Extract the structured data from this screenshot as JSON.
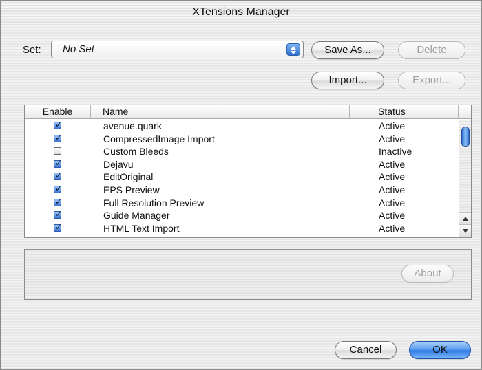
{
  "window": {
    "title": "XTensions Manager"
  },
  "set": {
    "label": "Set:",
    "selected": "No Set"
  },
  "buttons": {
    "save_as": "Save As...",
    "delete": "Delete",
    "import": "Import...",
    "export": "Export...",
    "about": "About",
    "cancel": "Cancel",
    "ok": "OK"
  },
  "table": {
    "columns": [
      "Enable",
      "Name",
      "Status"
    ],
    "rows": [
      {
        "enabled": true,
        "name": "avenue.quark",
        "status": "Active"
      },
      {
        "enabled": true,
        "name": "CompressedImage Import",
        "status": "Active"
      },
      {
        "enabled": false,
        "name": "Custom Bleeds",
        "status": "Inactive"
      },
      {
        "enabled": true,
        "name": "Dejavu",
        "status": "Active"
      },
      {
        "enabled": true,
        "name": "EditOriginal",
        "status": "Active"
      },
      {
        "enabled": true,
        "name": "EPS Preview",
        "status": "Active"
      },
      {
        "enabled": true,
        "name": "Full Resolution Preview",
        "status": "Active"
      },
      {
        "enabled": true,
        "name": "Guide Manager",
        "status": "Active"
      },
      {
        "enabled": true,
        "name": "HTML Text Import",
        "status": "Active"
      }
    ]
  },
  "icons": {
    "popup": "popup-arrows-icon",
    "checkbox": "checkbox-icon",
    "scroll_up": "scroll-up-arrow-icon",
    "scroll_down": "scroll-down-arrow-icon"
  },
  "colors": {
    "accent": "#2f7be6",
    "disabled_text": "#a0a0a0"
  }
}
